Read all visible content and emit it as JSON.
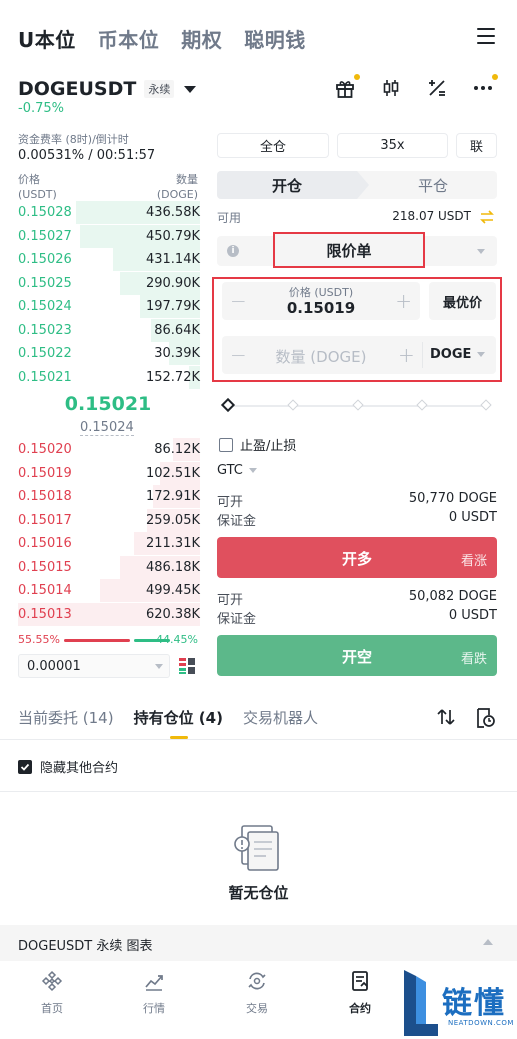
{
  "top_tabs": [
    "U本位",
    "币本位",
    "期权",
    "聪明钱"
  ],
  "symbol": {
    "name": "DOGEUSDT",
    "badge": "永续",
    "change": "-0.75%"
  },
  "funding": {
    "label": "资金费率 (8时)/倒计时",
    "value": "0.00531% / 00:51:57"
  },
  "orderbook": {
    "price_label": "价格",
    "price_unit": "(USDT)",
    "qty_label": "数量",
    "qty_unit": "(DOGE)",
    "bids": [
      {
        "price": "0.15028",
        "qty": "436.58K",
        "depth": 0.68
      },
      {
        "price": "0.15027",
        "qty": "450.79K",
        "depth": 0.66
      },
      {
        "price": "0.15026",
        "qty": "431.14K",
        "depth": 0.48
      },
      {
        "price": "0.15025",
        "qty": "290.90K",
        "depth": 0.44
      },
      {
        "price": "0.15024",
        "qty": "197.79K",
        "depth": 0.33
      },
      {
        "price": "0.15023",
        "qty": "86.64K",
        "depth": 0.27
      },
      {
        "price": "0.15022",
        "qty": "30.39K",
        "depth": 0.17
      },
      {
        "price": "0.15021",
        "qty": "152.72K",
        "depth": 0.06
      }
    ],
    "mid_price": "0.15021",
    "mark_price": "0.15024",
    "asks": [
      {
        "price": "0.15020",
        "qty": "86.12K",
        "depth": 0.15
      },
      {
        "price": "0.15019",
        "qty": "102.51K",
        "depth": 0.22
      },
      {
        "price": "0.15018",
        "qty": "172.91K",
        "depth": 0.26
      },
      {
        "price": "0.15017",
        "qty": "259.05K",
        "depth": 0.29
      },
      {
        "price": "0.15016",
        "qty": "211.31K",
        "depth": 0.36
      },
      {
        "price": "0.15015",
        "qty": "486.18K",
        "depth": 0.44
      },
      {
        "price": "0.15014",
        "qty": "499.45K",
        "depth": 0.55
      },
      {
        "price": "0.15013",
        "qty": "620.38K",
        "depth": 1.0
      }
    ],
    "ratio_sell": "55.55%",
    "ratio_buy": "44.45%",
    "precision": "0.00001"
  },
  "trade": {
    "margin_mode": "全仓",
    "leverage": "35x",
    "link": "联",
    "open_label": "开仓",
    "close_label": "平仓",
    "available_label": "可用",
    "available_value": "218.07 USDT",
    "order_type": "限价单",
    "price_label": "价格 (USDT)",
    "price_value": "0.15019",
    "best_price": "最优价",
    "qty_placeholder": "数量 (DOGE)",
    "qty_unit": "DOGE",
    "tpsl_label": "止盈/止损",
    "tif": "GTC",
    "long": {
      "can_open_label": "可开",
      "can_open_value": "50,770 DOGE",
      "margin_label": "保证金",
      "margin_value": "0 USDT",
      "button": "开多",
      "sub": "看涨"
    },
    "short": {
      "can_open_label": "可开",
      "can_open_value": "50,082 DOGE",
      "margin_label": "保证金",
      "margin_value": "0 USDT",
      "button": "开空",
      "sub": "看跌"
    }
  },
  "bottom_tabs": {
    "open_orders": "当前委托 (14)",
    "positions": "持有仓位 (4)",
    "bots": "交易机器人"
  },
  "hide_other": "隐藏其他合约",
  "empty_text": "暂无仓位",
  "chart_bar": "DOGEUSDT 永续  图表",
  "nav": {
    "home": "首页",
    "markets": "行情",
    "trade": "交易",
    "futures": "合约"
  },
  "watermark": {
    "text": "链懂",
    "sub": "NEATDOWN.COM"
  },
  "colors": {
    "green": "#2ebd85",
    "red": "#e04050",
    "accent": "#f0b90b",
    "highlight_box": "#e53945"
  }
}
